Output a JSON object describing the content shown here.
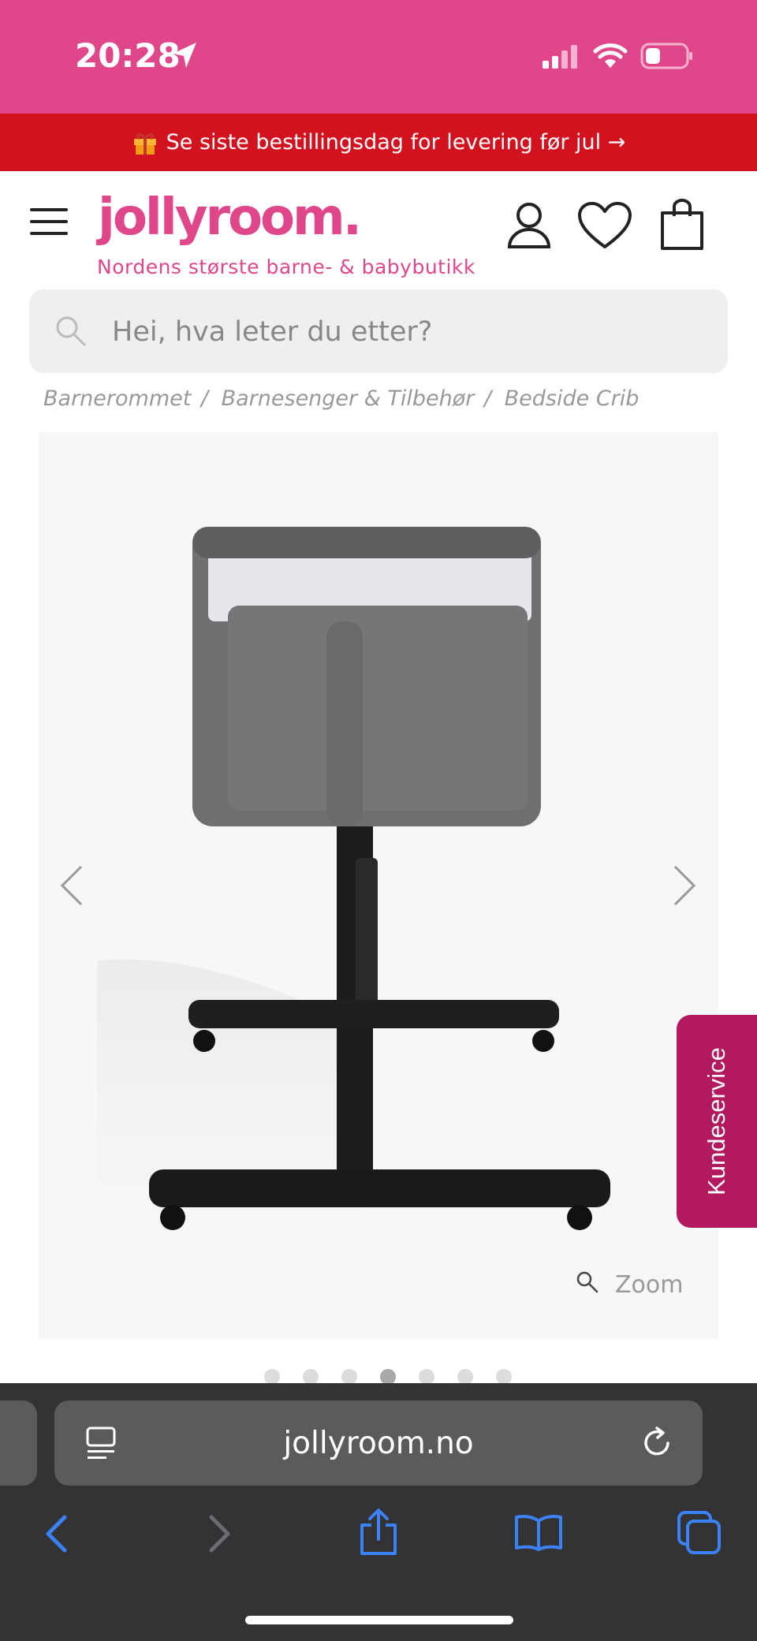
{
  "status_bar": {
    "time": "20:28"
  },
  "promo": {
    "text": "Se siste bestillingsdag for levering før jul →"
  },
  "header": {
    "logo": "jollyroom.",
    "tagline": "Nordens største barne- & babybutikk"
  },
  "search": {
    "placeholder": "Hei, hva leter du etter?"
  },
  "breadcrumb": {
    "items": [
      "Barnerommet",
      "Barnesenger & Tilbehør",
      "Bedside Crib"
    ],
    "separator": "/"
  },
  "product_gallery": {
    "zoom_label": "Zoom",
    "image_count": 7,
    "active_index": 3
  },
  "customer_service": {
    "label": "Kundeservice"
  },
  "browser": {
    "url": "jollyroom.no"
  },
  "colors": {
    "brand_pink": "#e0468a",
    "promo_red": "#d2121f",
    "service_magenta": "#b2195f",
    "ios_blue": "#3b82f6"
  },
  "icons": [
    "location-arrow-icon",
    "signal-icon",
    "wifi-icon",
    "battery-icon",
    "gift-icon",
    "menu-icon",
    "account-icon",
    "heart-icon",
    "shopping-bag-icon",
    "search-icon",
    "chevron-left-icon",
    "chevron-right-icon",
    "zoom-icon",
    "reader-icon",
    "reload-icon",
    "back-icon",
    "forward-icon",
    "share-icon",
    "bookmarks-icon",
    "tabs-icon"
  ]
}
